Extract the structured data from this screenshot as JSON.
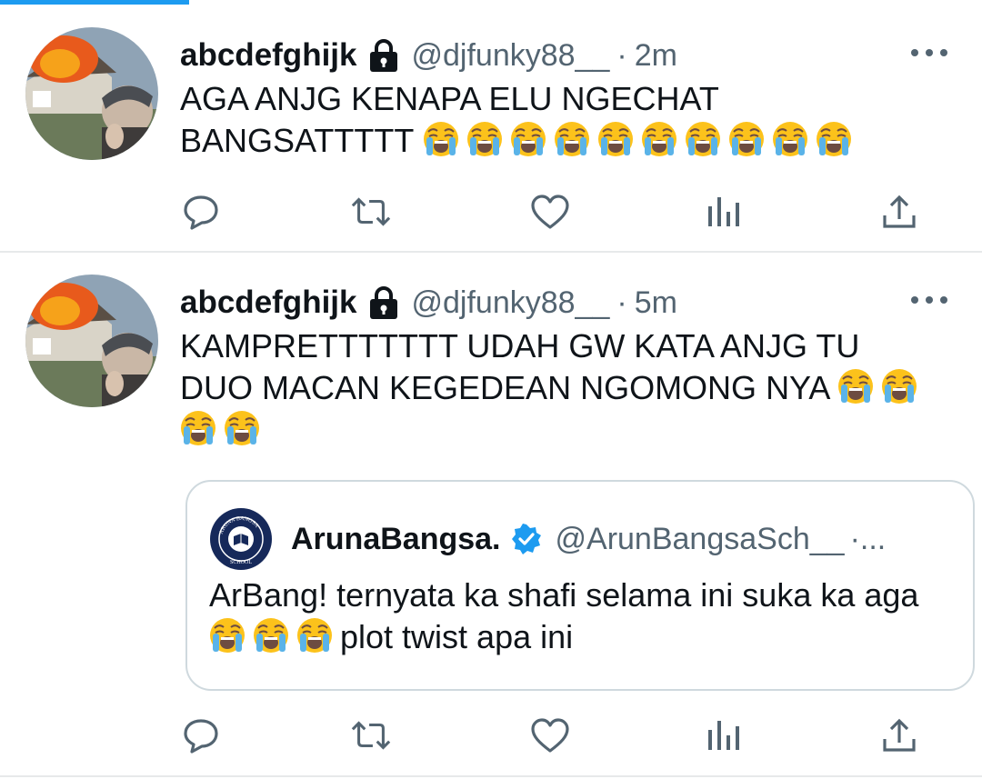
{
  "colors": {
    "accent": "#1d9bf0",
    "muted": "#536471",
    "text": "#0f1419",
    "border": "#cfd9de"
  },
  "tweets": [
    {
      "name": "abcdefghijk",
      "handle": "@djfunky88__",
      "dot": "·",
      "time": "2m",
      "text": "AGA ANJG KENAPA ELU NGECHAT BANGSATTTTT",
      "emoji_count": 10
    },
    {
      "name": "abcdefghijk",
      "handle": "@djfunky88__",
      "dot": "·",
      "time": "5m",
      "text": "KAMPRETTTTTTT UDAH GW KATA ANJG TU DUO MACAN KEGEDEAN NGOMONG NYA",
      "emoji_count": 4,
      "quote": {
        "name": "ArunaBangsa.",
        "handle": "@ArunBangsaSch__",
        "dot": "·...",
        "text_before": "ArBang! ternyata ka shafi selama ini suka ka aga",
        "emoji_count": 3,
        "text_after": "plot twist apa ini",
        "avatar_logo_text": "ARUNA BANGSA SCHOOL"
      }
    }
  ],
  "icons": {
    "lock": "lock-icon",
    "more": "more-options-icon",
    "reply": "reply-icon",
    "retweet": "retweet-icon",
    "like": "like-icon",
    "analytics": "analytics-icon",
    "share": "share-icon",
    "verified": "verified-badge-icon",
    "emoji": "loudly-crying-face-emoji"
  }
}
